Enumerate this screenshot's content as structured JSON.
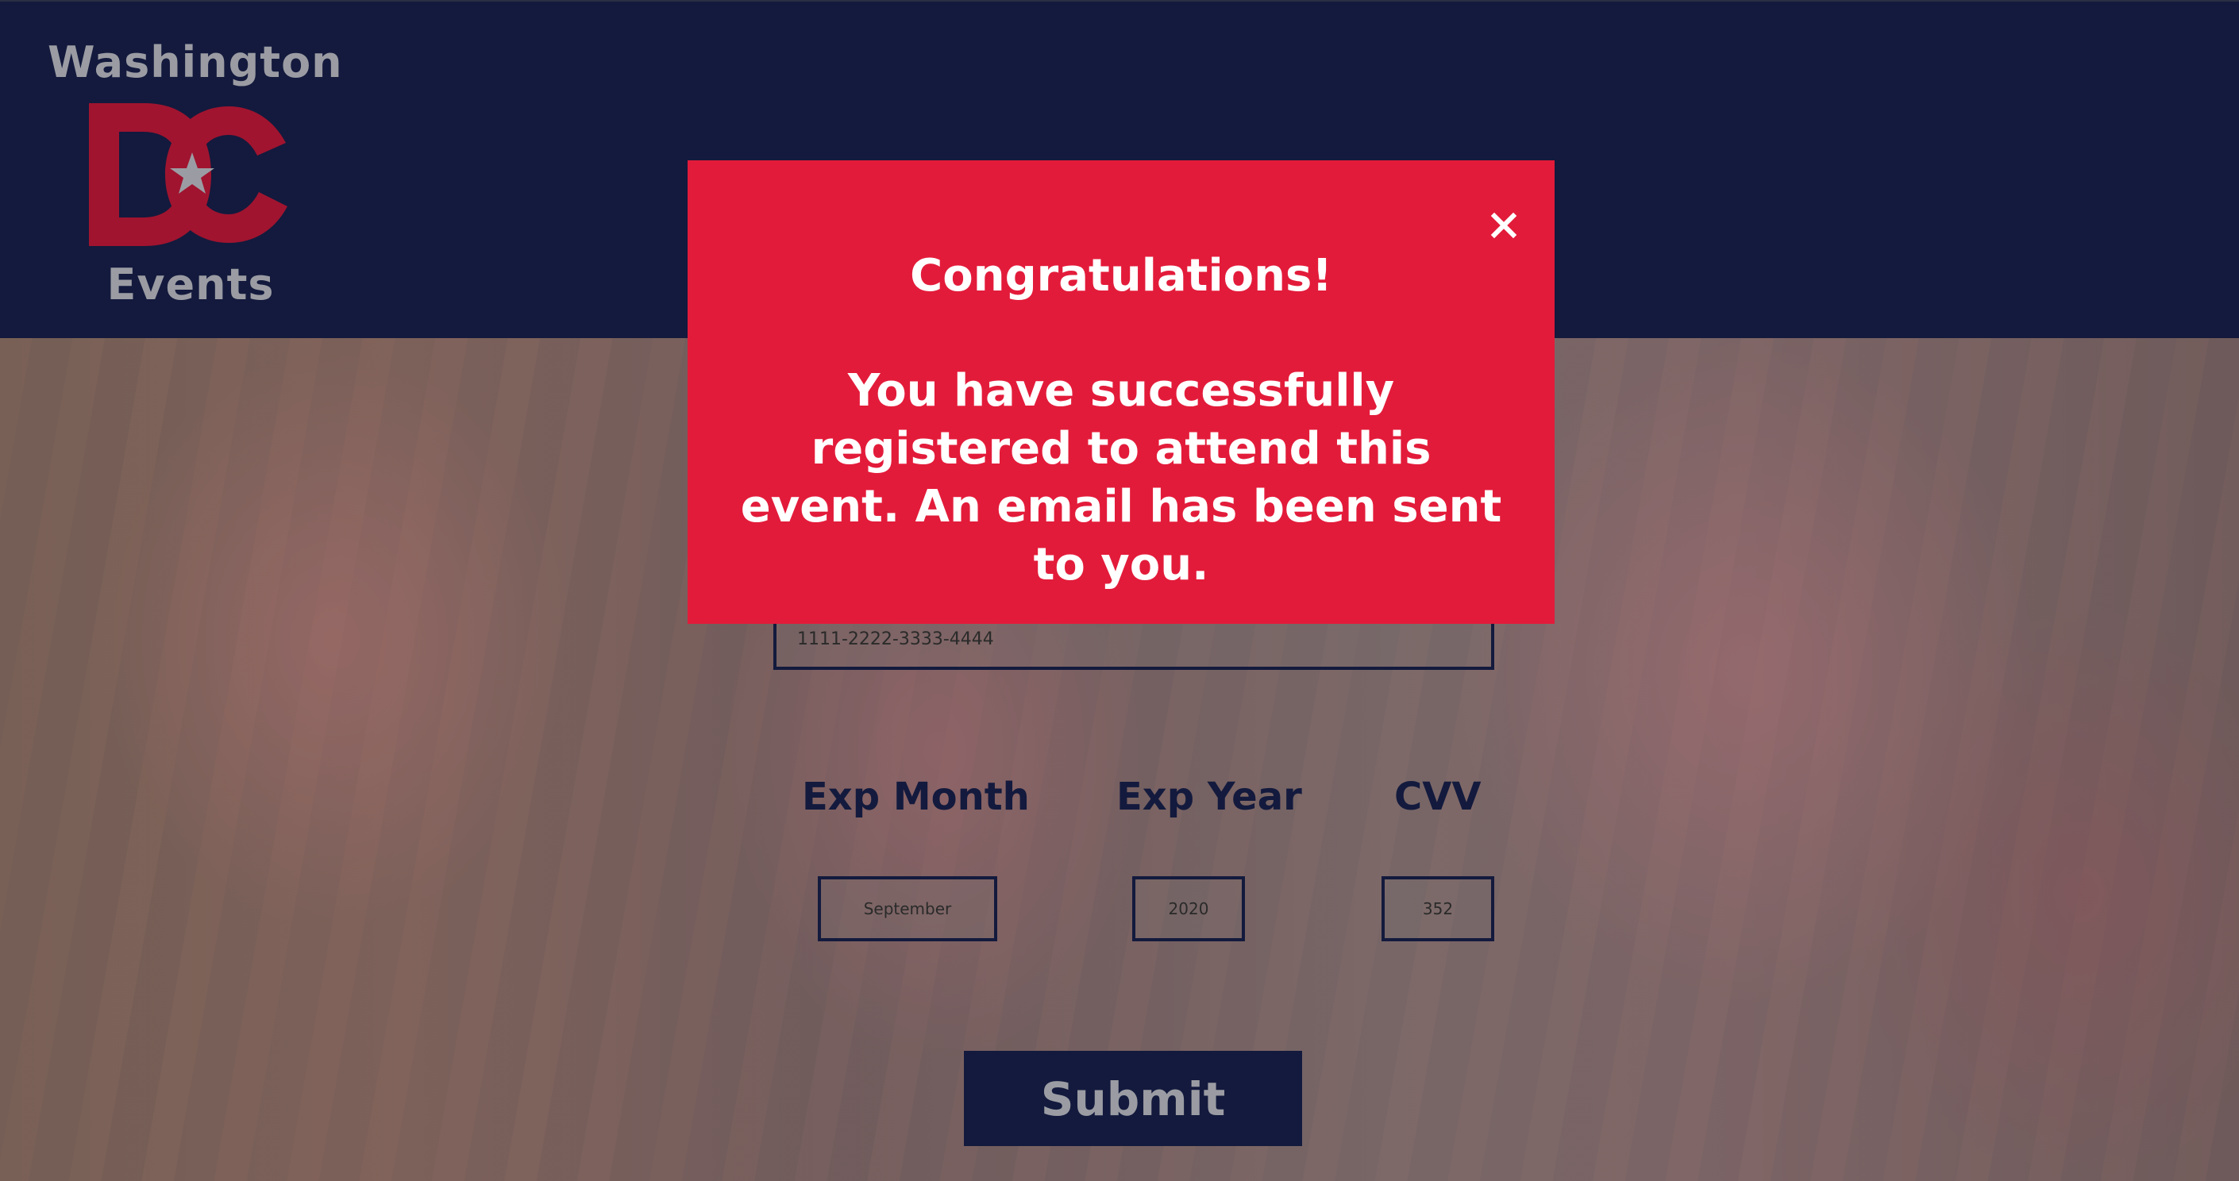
{
  "header": {
    "logo": {
      "top_text": "Washington",
      "mark_text": "DC",
      "bottom_text": "Events"
    }
  },
  "form": {
    "card_number_value": "1111-2222-3333-4444",
    "exp_month_label": "Exp Month",
    "exp_year_label": "Exp Year",
    "cvv_label": "CVV",
    "exp_month_value": "September",
    "exp_year_value": "2020",
    "cvv_value": "352",
    "submit_label": "Submit"
  },
  "modal": {
    "title": "Congratulations!",
    "message": "You have successfully registered to attend this event. An email has been sent to you.",
    "close_icon": "close-icon"
  },
  "colors": {
    "navy": "#131a3d",
    "modal_red": "#e31b3a",
    "logo_red": "#a0142f",
    "logo_gray": "#9b9ca3"
  }
}
